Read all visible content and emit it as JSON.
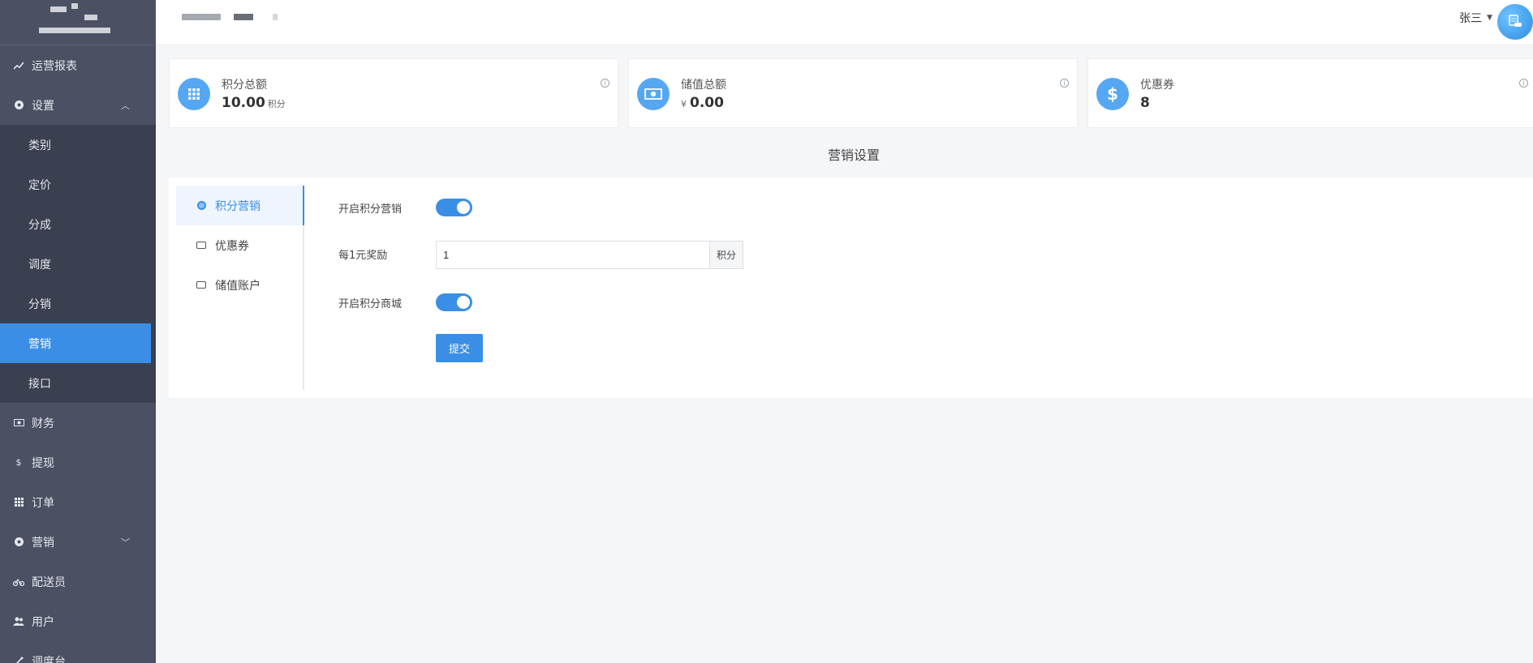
{
  "header": {
    "user_name": "张三"
  },
  "sidebar": {
    "items": [
      {
        "label": "运营报表",
        "icon": "trend-icon"
      },
      {
        "label": "设置",
        "icon": "settings-icon",
        "expanded": true
      },
      {
        "label": "财务",
        "icon": "money-icon"
      },
      {
        "label": "提现",
        "icon": "dollar-icon"
      },
      {
        "label": "订单",
        "icon": "grid-icon"
      },
      {
        "label": "营销",
        "icon": "marketing-icon",
        "expanded": false
      },
      {
        "label": "配送员",
        "icon": "bicycle-icon"
      },
      {
        "label": "用户",
        "icon": "users-icon"
      },
      {
        "label": "调度台",
        "icon": "dispatch-icon"
      }
    ],
    "settings_sub": [
      "类别",
      "定价",
      "分成",
      "调度",
      "分销",
      "营销",
      "接口"
    ],
    "active_sub": "营销"
  },
  "stats": [
    {
      "title": "积分总额",
      "value": "10.00",
      "unit": "积分",
      "prefix": "",
      "icon": "apps-icon"
    },
    {
      "title": "储值总额",
      "value": "0.00",
      "unit": "",
      "prefix": "¥",
      "icon": "banknote-icon"
    },
    {
      "title": "优惠券",
      "value": "8",
      "unit": "",
      "prefix": "",
      "icon": "dollar-icon"
    }
  ],
  "section_title": "营销设置",
  "tabs": [
    {
      "label": "积分营销",
      "active": true
    },
    {
      "label": "优惠券",
      "active": false
    },
    {
      "label": "储值账户",
      "active": false
    }
  ],
  "form": {
    "enable_points_label": "开启积分营销",
    "enable_points_on": true,
    "reward_label": "每1元奖励",
    "reward_value": "1",
    "reward_unit": "积分",
    "enable_mall_label": "开启积分商城",
    "enable_mall_on": true,
    "submit_label": "提交"
  },
  "colors": {
    "sidebar_bg": "#4b5163",
    "submenu_bg": "#3b4051",
    "accent": "#3a8ee6",
    "stat_icon": "#55a7f1"
  }
}
